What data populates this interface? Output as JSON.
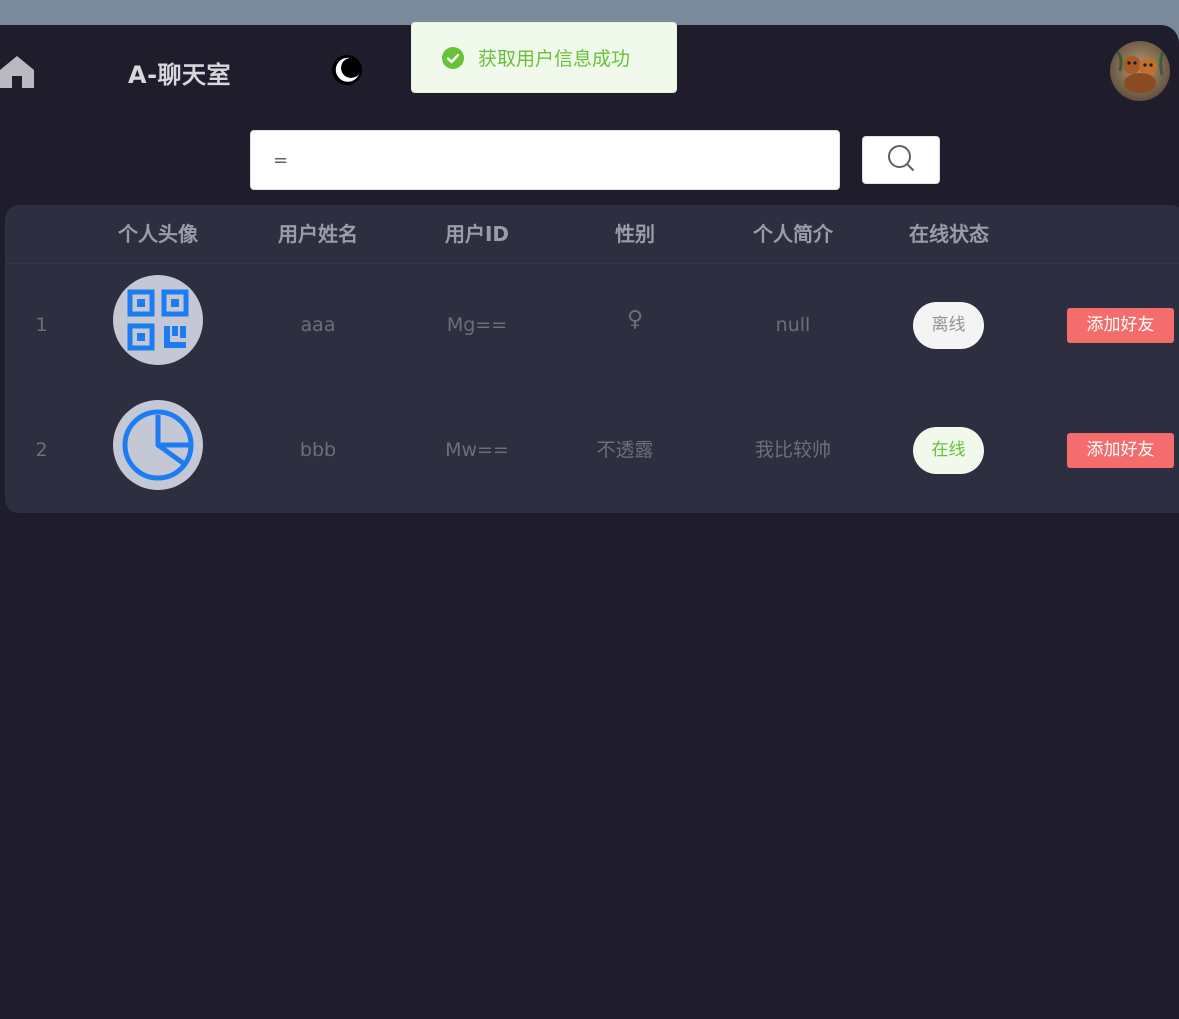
{
  "header": {
    "title": "A-聊天室"
  },
  "toast": {
    "message": "获取用户信息成功",
    "color": "#67c23a"
  },
  "search": {
    "value": "="
  },
  "table": {
    "columns": [
      "个人头像",
      "用户姓名",
      "用户ID",
      "性别",
      "个人简介",
      "在线状态"
    ],
    "rows": [
      {
        "index": "1",
        "avatar": "qr-code-icon",
        "name": "aaa",
        "id": "Mg==",
        "gender": "♀",
        "bio": "null",
        "status": "离线",
        "action": "添加好友"
      },
      {
        "index": "2",
        "avatar": "pie-chart-icon",
        "name": "bbb",
        "id": "Mw==",
        "gender": "不透露",
        "bio": "我比较帅",
        "status": "在线",
        "action": "添加好友"
      }
    ]
  },
  "colors": {
    "accent_blue": "#1e7cf2",
    "danger": "#f56c6c",
    "success": "#67c23a"
  }
}
